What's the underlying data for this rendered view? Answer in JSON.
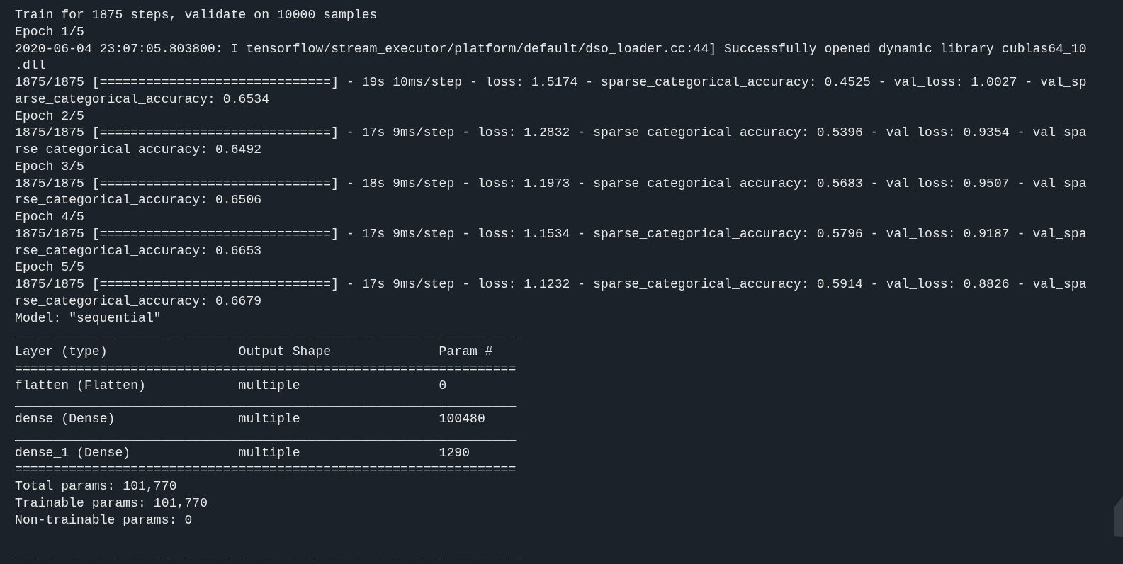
{
  "lines": [
    {
      "kind": "text",
      "text": "Train for 1875 steps, validate on 10000 samples"
    },
    {
      "kind": "text",
      "text": "Epoch 1/5"
    },
    {
      "kind": "text",
      "text": "2020-06-04 23:07:05.803800: I tensorflow/stream_executor/platform/default/dso_loader.cc:44] Successfully opened dynamic library cublas64_10"
    },
    {
      "kind": "text",
      "text": ".dll"
    },
    {
      "kind": "text",
      "text": "1875/1875 [==============================] - 19s 10ms/step - loss: 1.5174 - sparse_categorical_accuracy: 0.4525 - val_loss: 1.0027 - val_sp"
    },
    {
      "kind": "text",
      "text": "arse_categorical_accuracy: 0.6534"
    },
    {
      "kind": "text",
      "text": "Epoch 2/5"
    },
    {
      "kind": "text",
      "text": "1875/1875 [==============================] - 17s 9ms/step - loss: 1.2832 - sparse_categorical_accuracy: 0.5396 - val_loss: 0.9354 - val_spa"
    },
    {
      "kind": "text",
      "text": "rse_categorical_accuracy: 0.6492"
    },
    {
      "kind": "text",
      "text": "Epoch 3/5"
    },
    {
      "kind": "text",
      "text": "1875/1875 [==============================] - 18s 9ms/step - loss: 1.1973 - sparse_categorical_accuracy: 0.5683 - val_loss: 0.9507 - val_spa"
    },
    {
      "kind": "text",
      "text": "rse_categorical_accuracy: 0.6506"
    },
    {
      "kind": "text",
      "text": "Epoch 4/5"
    },
    {
      "kind": "text",
      "text": "1875/1875 [==============================] - 17s 9ms/step - loss: 1.1534 - sparse_categorical_accuracy: 0.5796 - val_loss: 0.9187 - val_spa"
    },
    {
      "kind": "text",
      "text": "rse_categorical_accuracy: 0.6653"
    },
    {
      "kind": "text",
      "text": "Epoch 5/5"
    },
    {
      "kind": "text",
      "text": "1875/1875 [==============================] - 17s 9ms/step - loss: 1.1232 - sparse_categorical_accuracy: 0.5914 - val_loss: 0.8826 - val_spa"
    },
    {
      "kind": "text",
      "text": "rse_categorical_accuracy: 0.6679"
    },
    {
      "kind": "text",
      "text": "Model: \"sequential\""
    },
    {
      "kind": "text",
      "text": "_________________________________________________________________"
    },
    {
      "kind": "text",
      "text": "Layer (type)                 Output Shape              Param #   "
    },
    {
      "kind": "text",
      "text": "================================================================="
    },
    {
      "kind": "text",
      "text": "flatten (Flatten)            multiple                  0         "
    },
    {
      "kind": "text",
      "text": "_________________________________________________________________"
    },
    {
      "kind": "text",
      "text": "dense (Dense)                multiple                  100480    "
    },
    {
      "kind": "text",
      "text": "_________________________________________________________________"
    },
    {
      "kind": "text",
      "text": "dense_1 (Dense)              multiple                  1290      "
    },
    {
      "kind": "text",
      "text": "================================================================="
    },
    {
      "kind": "text",
      "text": "Total params: 101,770"
    },
    {
      "kind": "text",
      "text": "Trainable params: 101,770"
    },
    {
      "kind": "text",
      "text": "Non-trainable params: 0"
    },
    {
      "kind": "blank"
    },
    {
      "kind": "text",
      "text": "_________________________________________________________________"
    }
  ]
}
